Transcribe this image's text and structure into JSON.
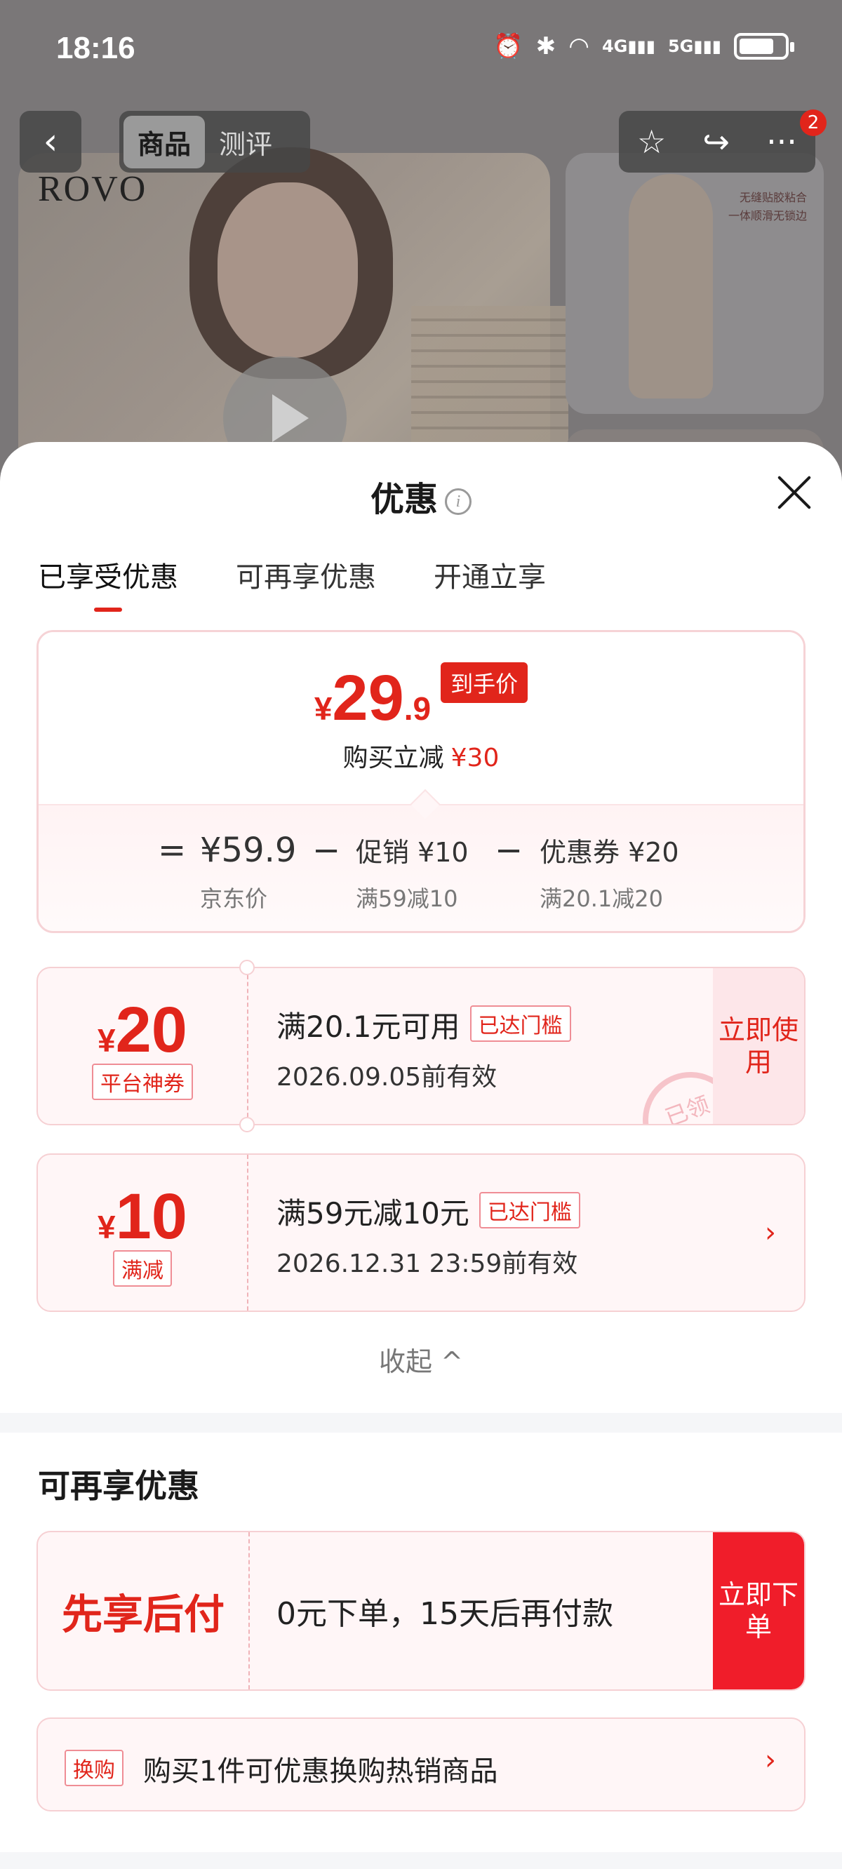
{
  "status_bar": {
    "time": "18:16",
    "network1": "4G",
    "network2": "5G"
  },
  "nav": {
    "back_icon": "chevron-left",
    "tabs": [
      "商品",
      "测评"
    ],
    "cart_badge": "2"
  },
  "background": {
    "brand_logo": "ROVO",
    "thumb_text1": "无缝贴胶粘合",
    "thumb_text2": "一体顺滑无锁边"
  },
  "sheet": {
    "title": "优惠",
    "tabs": [
      "已享受优惠",
      "可再享优惠",
      "开通立享"
    ],
    "summary": {
      "currency": "¥",
      "price_int": "29",
      "price_dec": ".9",
      "price_tag": "到手价",
      "reduce_label": "购买立减",
      "reduce_amount": "¥30",
      "eq": "=",
      "base_price": "¥59.9",
      "base_label": "京东价",
      "minus": "−",
      "promo": "促销 ¥10",
      "promo_sub": "满59减10",
      "coupon": "优惠券 ¥20",
      "coupon_sub": "满20.1减20"
    },
    "coupons": [
      {
        "currency": "¥",
        "amount": "20",
        "label": "平台神券",
        "condition": "满20.1元可用",
        "reached": "已达门槛",
        "expire": "2026.09.05前有效",
        "action": "立即使用",
        "stamp": "已领"
      },
      {
        "currency": "¥",
        "amount": "10",
        "label": "满减",
        "condition": "满59元减10元",
        "reached": "已达门槛",
        "expire": "2026.12.31 23:59前有效"
      }
    ],
    "collapse": "收起 ^",
    "section2_title": "可再享优惠",
    "bnpl": {
      "title": "先享后付",
      "desc": "0元下单，15天后再付款",
      "action": "立即下单"
    },
    "swap": {
      "tag": "换购",
      "text": "购买1件可优惠换购热销商品"
    }
  },
  "colors": {
    "accent": "#e1251b",
    "coupon_bg": "#fff6f7"
  }
}
